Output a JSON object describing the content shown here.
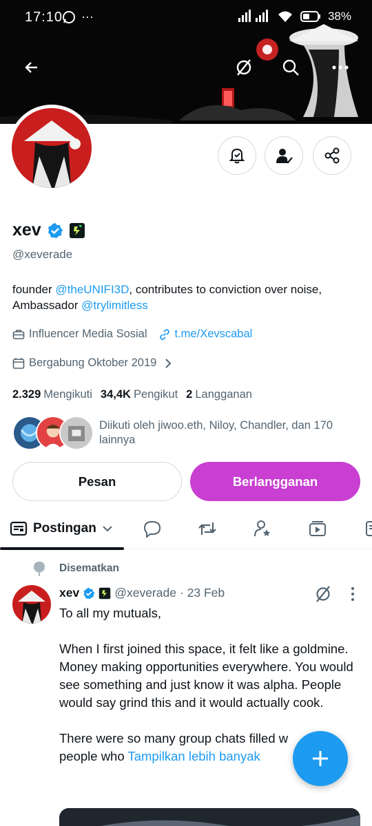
{
  "status_bar": {
    "time": "17:10",
    "battery": "38%"
  },
  "profile": {
    "display_name": "xev",
    "handle": "@xeverade",
    "bio_prefix": "founder ",
    "bio_link_1": "@theUNIFI3D",
    "bio_middle": ", contributes to conviction over noise, Ambassador ",
    "bio_link_2": "@trylimitless",
    "category": "Influencer Media Sosial",
    "website": "t.me/Xevscabal",
    "joined": "Bergabung Oktober 2019",
    "stats": {
      "following_count": "2.329",
      "following_label": "Mengikuti",
      "followers_count": "34,4K",
      "followers_label": "Pengikut",
      "subs_count": "2",
      "subs_label": "Langganan"
    },
    "followed_by": "Diikuti oleh jiwoo.eth, Niloy, Chandler, dan 170 lainnya"
  },
  "buttons": {
    "message": "Pesan",
    "subscribe": "Berlangganan"
  },
  "tabs": {
    "active_label": "Postingan"
  },
  "post": {
    "pinned_label": "Disematkan",
    "name": "xev",
    "handle": "@xeverade",
    "date": "· 23 Feb",
    "text": "To all my mutuals,\n\nWhen I first joined this space, it felt like a goldmine.\nMoney making opportunities everywhere. You would see something and just know it was alpha. People would say grind this and it would actually cook.\n\nThere were so many group chats filled w",
    "text_tail": "people who ",
    "show_more": "Tampilkan lebih banyak"
  },
  "colors": {
    "accent": "#1d9bf0",
    "subscribe": "#c83fd1",
    "verified": "#1d9bf0"
  },
  "icons": [
    "back-arrow-icon",
    "grok-icon",
    "search-icon",
    "more-icon",
    "bell-plus-icon",
    "person-check-icon",
    "share-icon",
    "verified-badge-icon",
    "affiliate-badge-icon",
    "briefcase-icon",
    "link-icon",
    "calendar-icon",
    "chevron-right-icon",
    "posts-tab-icon",
    "reply-tab-icon",
    "repost-tab-icon",
    "subscription-tab-icon",
    "media-tab-icon",
    "pin-icon",
    "plus-icon"
  ]
}
